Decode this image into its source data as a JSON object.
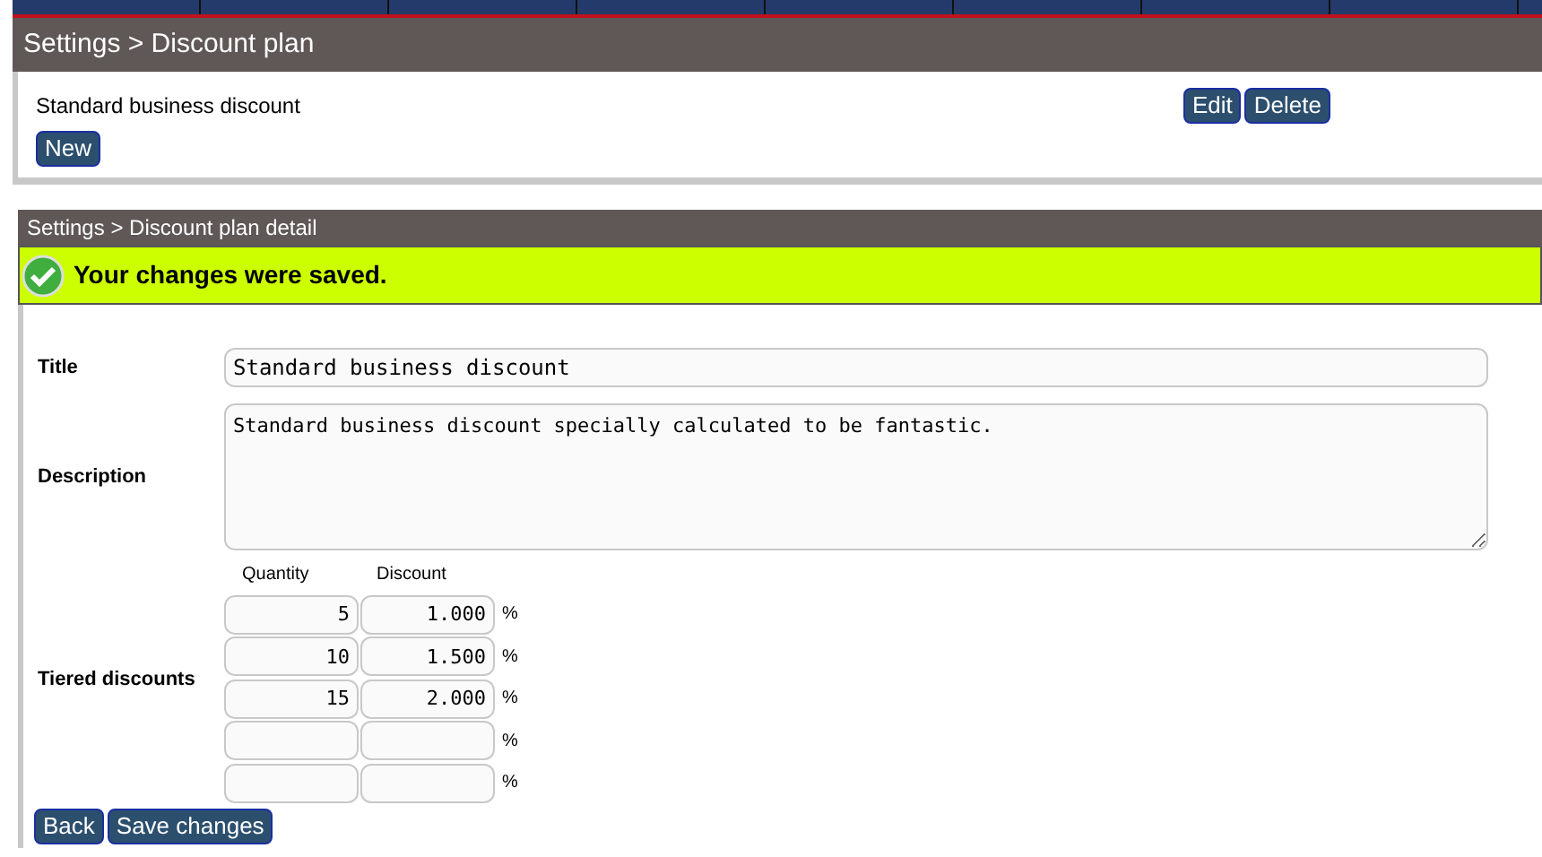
{
  "plan_panel": {
    "breadcrumb": "Settings > Discount plan",
    "plans": [
      {
        "name": "Standard business discount",
        "actions": [
          "Edit",
          "Delete"
        ]
      }
    ],
    "new_button": "New"
  },
  "detail_panel": {
    "breadcrumb": "Settings > Discount plan detail",
    "notice": {
      "kind": "success",
      "text": "Your changes were saved."
    },
    "fields": [
      {
        "kind": "text",
        "label": "Title",
        "value": "Standard business discount"
      },
      {
        "kind": "textarea",
        "label": "Description",
        "value": "Standard business discount specially calculated to be fantastic."
      },
      {
        "kind": "tiers",
        "label": "Tiered discounts",
        "columns": [
          "Quantity",
          "Discount"
        ],
        "rows": [
          {
            "quantity": "5",
            "discount": "1.000",
            "unit": "%"
          },
          {
            "quantity": "10",
            "discount": "1.500",
            "unit": "%"
          },
          {
            "quantity": "15",
            "discount": "2.000",
            "unit": "%"
          },
          {
            "unit": "%"
          },
          {
            "unit": "%"
          }
        ]
      }
    ],
    "buttons": [
      "Back",
      "Save changes"
    ]
  }
}
